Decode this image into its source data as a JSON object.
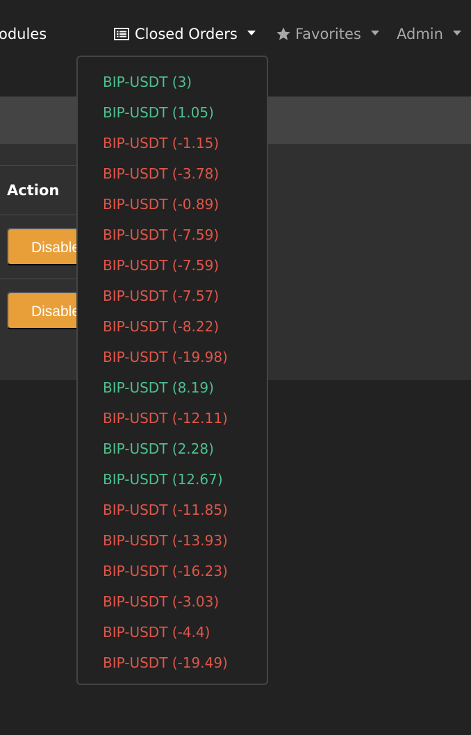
{
  "navbar": {
    "modules_label": "odules",
    "closed_orders_label": "Closed Orders",
    "favorites_label": "Favorites",
    "admin_label": "Admin"
  },
  "table": {
    "action_header": "Action",
    "rows": [
      {
        "button_label": "Disable"
      },
      {
        "button_label": "Disable"
      }
    ]
  },
  "colors": {
    "positive": "#4fbf8f",
    "negative": "#e0564a",
    "warning_button": "#e89f3a"
  },
  "closed_orders_menu": [
    {
      "label": "BIP-USDT (3)",
      "status": "positive"
    },
    {
      "label": "BIP-USDT (1.05)",
      "status": "positive"
    },
    {
      "label": "BIP-USDT (-1.15)",
      "status": "negative"
    },
    {
      "label": "BIP-USDT (-3.78)",
      "status": "negative"
    },
    {
      "label": "BIP-USDT (-0.89)",
      "status": "negative"
    },
    {
      "label": "BIP-USDT (-7.59)",
      "status": "negative"
    },
    {
      "label": "BIP-USDT (-7.59)",
      "status": "negative"
    },
    {
      "label": "BIP-USDT (-7.57)",
      "status": "negative"
    },
    {
      "label": "BIP-USDT (-8.22)",
      "status": "negative"
    },
    {
      "label": "BIP-USDT (-19.98)",
      "status": "negative"
    },
    {
      "label": "BIP-USDT (8.19)",
      "status": "positive"
    },
    {
      "label": "BIP-USDT (-12.11)",
      "status": "negative"
    },
    {
      "label": "BIP-USDT (2.28)",
      "status": "positive"
    },
    {
      "label": "BIP-USDT (12.67)",
      "status": "positive"
    },
    {
      "label": "BIP-USDT (-11.85)",
      "status": "negative"
    },
    {
      "label": "BIP-USDT (-13.93)",
      "status": "negative"
    },
    {
      "label": "BIP-USDT (-16.23)",
      "status": "negative"
    },
    {
      "label": "BIP-USDT (-3.03)",
      "status": "negative"
    },
    {
      "label": "BIP-USDT (-4.4)",
      "status": "negative"
    },
    {
      "label": "BIP-USDT (-19.49)",
      "status": "negative"
    }
  ]
}
